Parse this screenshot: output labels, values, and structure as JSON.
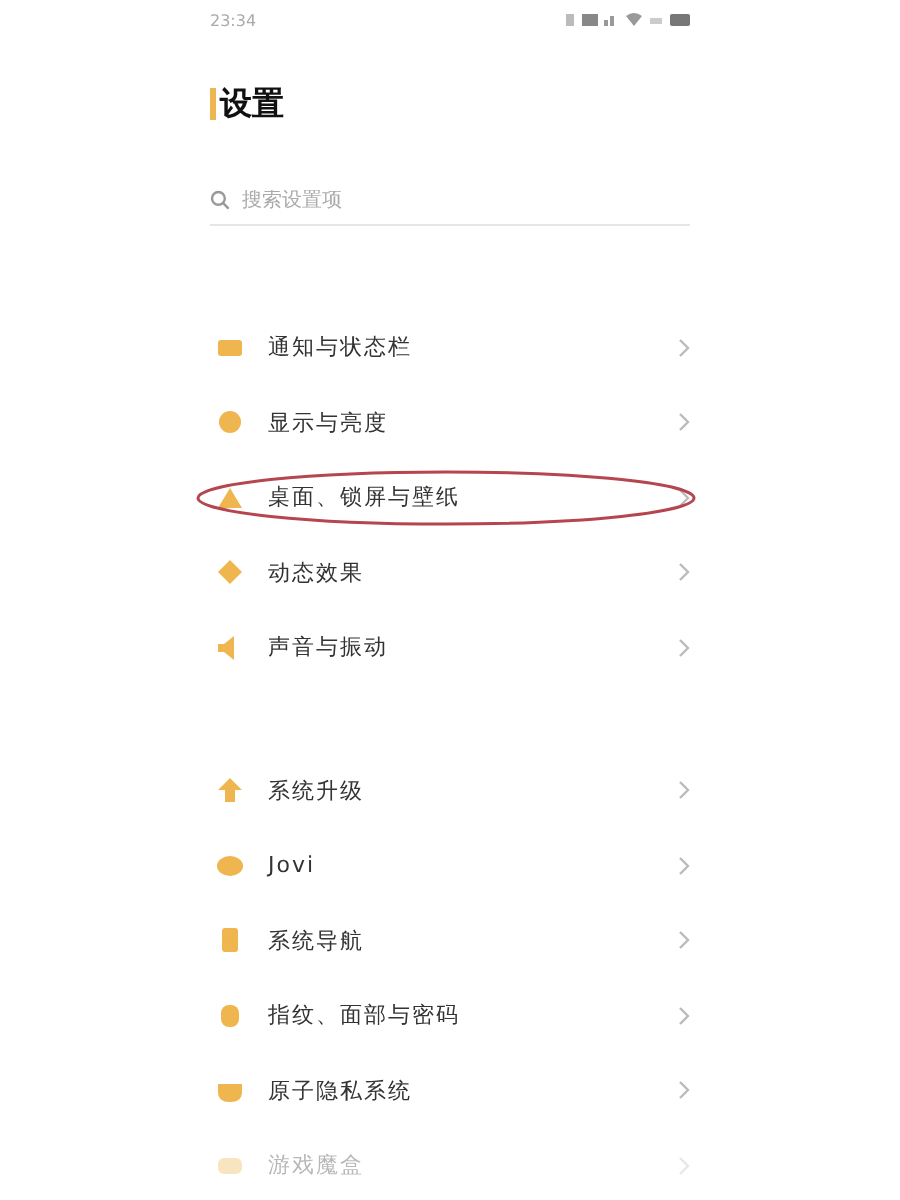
{
  "status_bar": {
    "time": "23:34"
  },
  "title": "设置",
  "search": {
    "placeholder": "搜索设置项"
  },
  "groups": [
    {
      "items": [
        {
          "label": "通知与状态栏",
          "circled": false,
          "faded": false
        },
        {
          "label": "显示与亮度",
          "circled": false,
          "faded": false
        },
        {
          "label": "桌面、锁屏与壁纸",
          "circled": true,
          "faded": false
        },
        {
          "label": "动态效果",
          "circled": false,
          "faded": false
        },
        {
          "label": "声音与振动",
          "circled": false,
          "faded": false
        }
      ]
    },
    {
      "items": [
        {
          "label": "系统升级",
          "circled": false,
          "faded": false
        },
        {
          "label": "Jovi",
          "circled": false,
          "faded": false
        },
        {
          "label": "系统导航",
          "circled": false,
          "faded": false
        },
        {
          "label": "指纹、面部与密码",
          "circled": false,
          "faded": false
        },
        {
          "label": "原子隐私系统",
          "circled": false,
          "faded": false
        },
        {
          "label": "游戏魔盒",
          "circled": false,
          "faded": true
        }
      ]
    }
  ]
}
